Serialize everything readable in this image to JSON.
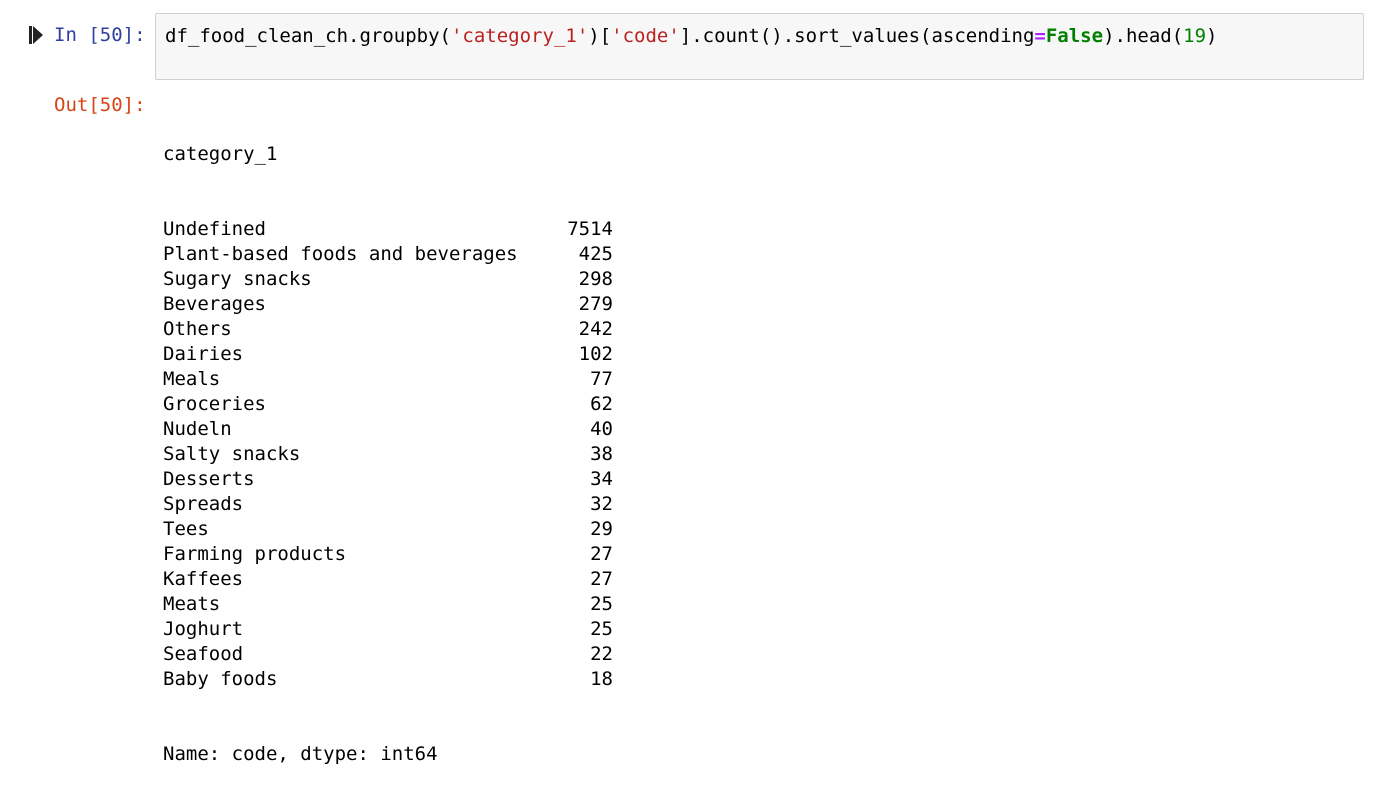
{
  "input_cell": {
    "prompt": "In [50]:",
    "code_tokens": [
      {
        "text": "df_food_clean_ch.groupby(",
        "kind": "plain"
      },
      {
        "text": "'category_1'",
        "kind": "str"
      },
      {
        "text": ")[",
        "kind": "plain"
      },
      {
        "text": "'code'",
        "kind": "str"
      },
      {
        "text": "].count().sort_values(ascending",
        "kind": "plain"
      },
      {
        "text": "=",
        "kind": "op"
      },
      {
        "text": "False",
        "kind": "kw"
      },
      {
        "text": ").head(",
        "kind": "plain"
      },
      {
        "text": "19",
        "kind": "num"
      },
      {
        "text": ")",
        "kind": "plain"
      }
    ]
  },
  "output_cell": {
    "prompt": "Out[50]:",
    "index_name": "category_1",
    "rows": [
      {
        "label": "Undefined",
        "value": "7514"
      },
      {
        "label": "Plant-based foods and beverages",
        "value": "425"
      },
      {
        "label": "Sugary snacks",
        "value": "298"
      },
      {
        "label": "Beverages",
        "value": "279"
      },
      {
        "label": "Others",
        "value": "242"
      },
      {
        "label": "Dairies",
        "value": "102"
      },
      {
        "label": "Meals",
        "value": "77"
      },
      {
        "label": "Groceries",
        "value": "62"
      },
      {
        "label": "Nudeln",
        "value": "40"
      },
      {
        "label": "Salty snacks",
        "value": "38"
      },
      {
        "label": "Desserts",
        "value": "34"
      },
      {
        "label": "Spreads",
        "value": "32"
      },
      {
        "label": "Tees",
        "value": "29"
      },
      {
        "label": "Farming products",
        "value": "27"
      },
      {
        "label": "Kaffees",
        "value": "27"
      },
      {
        "label": "Meats",
        "value": "25"
      },
      {
        "label": "Joghurt",
        "value": "25"
      },
      {
        "label": "Seafood",
        "value": "22"
      },
      {
        "label": "Baby foods",
        "value": "18"
      }
    ],
    "footer": "Name: code, dtype: int64"
  },
  "icons": {
    "run_indicator": "step-forward-icon"
  }
}
